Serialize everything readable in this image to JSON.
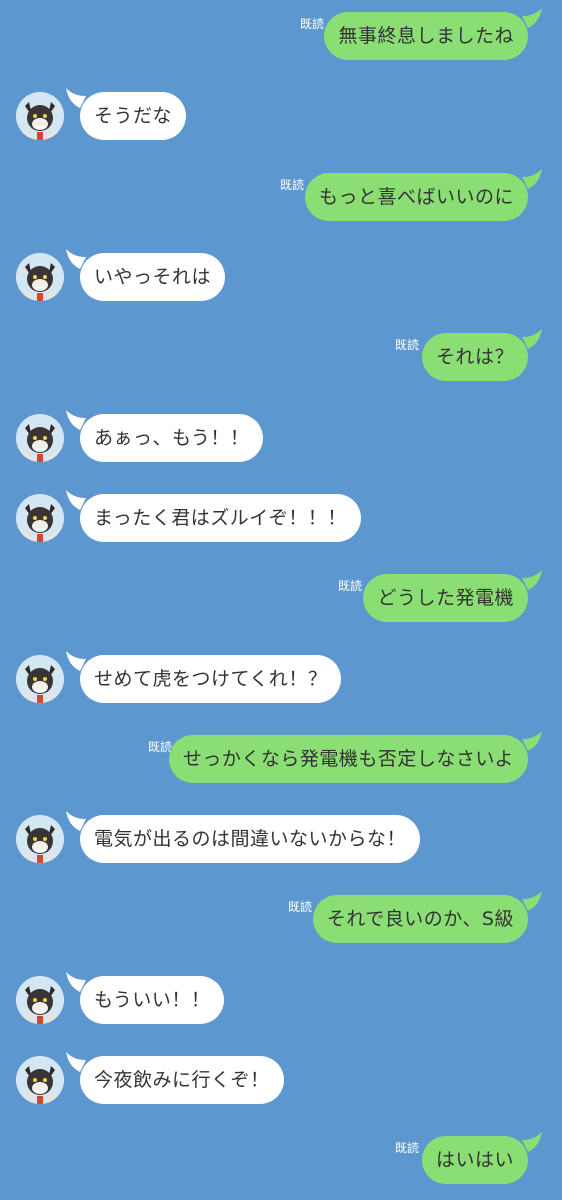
{
  "read_label": "既読",
  "messages": [
    {
      "side": "right",
      "text": "無事終息しましたね",
      "read": true
    },
    {
      "side": "left",
      "text": "そうだな"
    },
    {
      "side": "right",
      "text": "もっと喜べばいいのに",
      "read": true
    },
    {
      "side": "left",
      "text": "いやっそれは"
    },
    {
      "side": "right",
      "text": "それは？",
      "read": true
    },
    {
      "side": "left",
      "text": "あぁっ、もう！！"
    },
    {
      "side": "left",
      "text": "まったく君はズルイぞ！！！"
    },
    {
      "side": "right",
      "text": "どうした発電機",
      "read": true
    },
    {
      "side": "left",
      "text": "せめて虎をつけてくれ！？"
    },
    {
      "side": "right",
      "text": "せっかくなら発電機も否定しなさいよ",
      "read": true
    },
    {
      "side": "left",
      "text": "電気が出るのは間違いないからな！"
    },
    {
      "side": "right",
      "text": "それで良いのか、S級",
      "read": true
    },
    {
      "side": "left",
      "text": "もういい！！"
    },
    {
      "side": "left",
      "text": "今夜飲みに行くぞ！"
    },
    {
      "side": "right",
      "text": "はいはい",
      "read": true
    }
  ],
  "colors": {
    "background": "#5d97cf",
    "outgoing_bubble": "#8ade73",
    "incoming_bubble": "#ffffff"
  },
  "icons": {
    "avatar": "avatar-icon"
  }
}
